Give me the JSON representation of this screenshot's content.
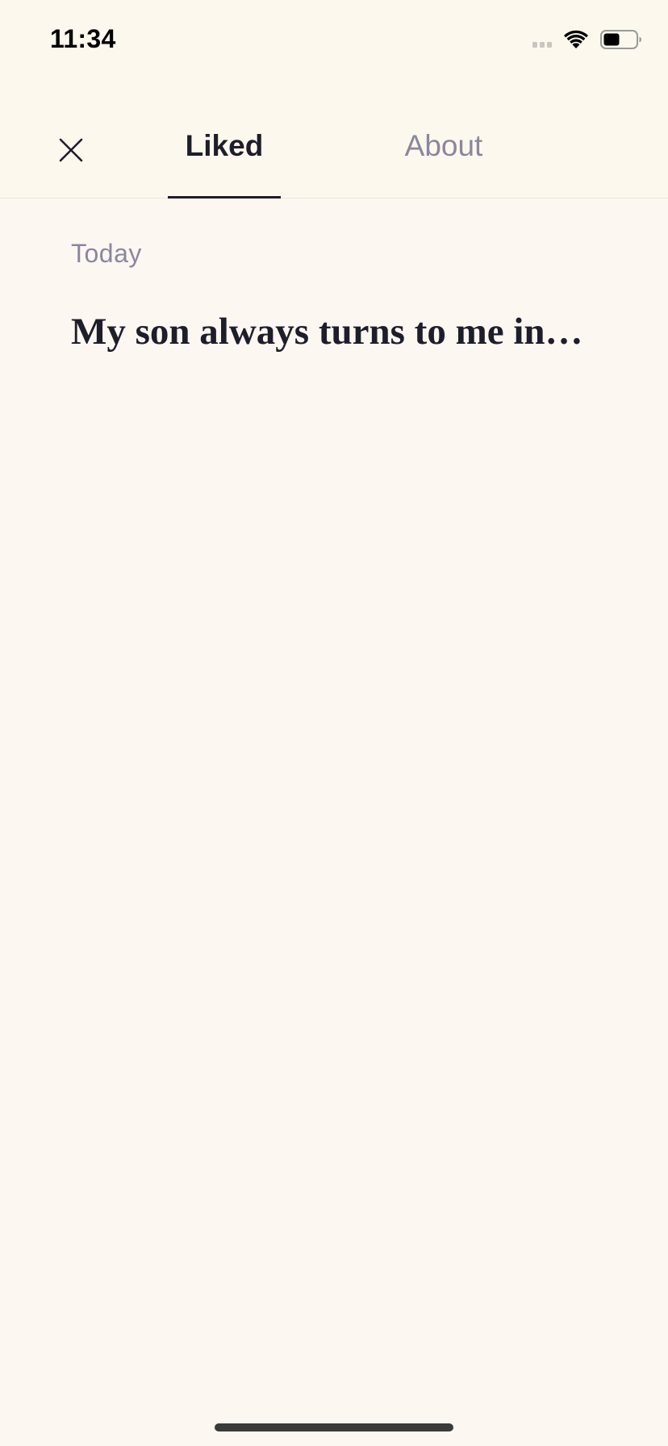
{
  "status_bar": {
    "time": "11:34",
    "icons": [
      "cellular-signal-icon",
      "wifi-icon",
      "battery-icon"
    ]
  },
  "nav": {
    "close_icon": "close-icon",
    "tabs": [
      {
        "label": "Liked",
        "active": true
      },
      {
        "label": "About",
        "active": false
      }
    ]
  },
  "liked": {
    "sections": [
      {
        "date": "Today",
        "items": [
          {
            "title": "My son always turns to me in…"
          }
        ]
      }
    ]
  },
  "colors": {
    "background": "#fdf7f2",
    "header_background": "#fcf8ee",
    "text_primary": "#1e1d2a",
    "text_secondary": "#8b879c"
  }
}
